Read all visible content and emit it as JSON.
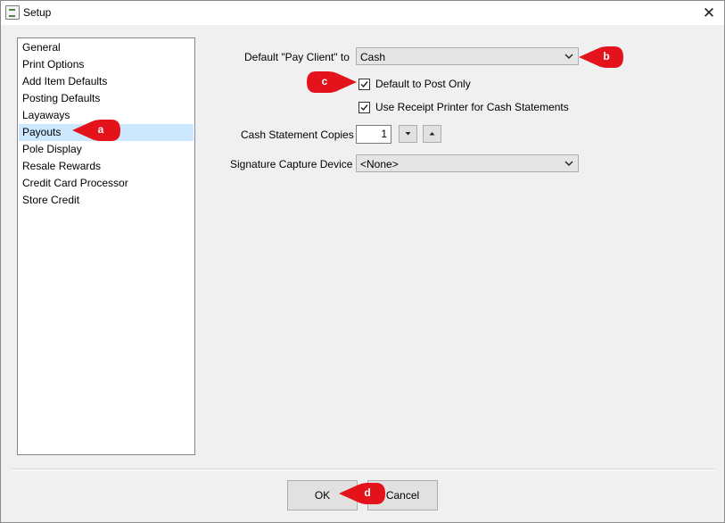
{
  "window": {
    "title": "Setup",
    "icon": "setup-app-icon",
    "close_glyph": "✕"
  },
  "sidebar": {
    "items": [
      {
        "label": "General",
        "selected": false
      },
      {
        "label": "Print Options",
        "selected": false
      },
      {
        "label": "Add Item Defaults",
        "selected": false
      },
      {
        "label": "Posting Defaults",
        "selected": false
      },
      {
        "label": "Layaways",
        "selected": false
      },
      {
        "label": "Payouts",
        "selected": true
      },
      {
        "label": "Pole Display",
        "selected": false
      },
      {
        "label": "Resale Rewards",
        "selected": false
      },
      {
        "label": "Credit Card Processor",
        "selected": false
      },
      {
        "label": "Store Credit",
        "selected": false
      }
    ]
  },
  "form": {
    "pay_client_label": "Default \"Pay Client\" to",
    "pay_client_value": "Cash",
    "default_post_only_label": "Default to Post Only",
    "default_post_only_checked": true,
    "receipt_printer_label": "Use Receipt Printer for Cash Statements",
    "receipt_printer_checked": true,
    "copies_label": "Cash Statement Copies",
    "copies_value": "1",
    "signature_label": "Signature Capture Device",
    "signature_value": "<None>"
  },
  "buttons": {
    "ok_label": "OK",
    "cancel_label": "Cancel"
  },
  "callouts": {
    "a": "a",
    "b": "b",
    "c": "c",
    "d": "d"
  },
  "colors": {
    "callout_red": "#e3121b",
    "selection": "#cce8ff"
  }
}
